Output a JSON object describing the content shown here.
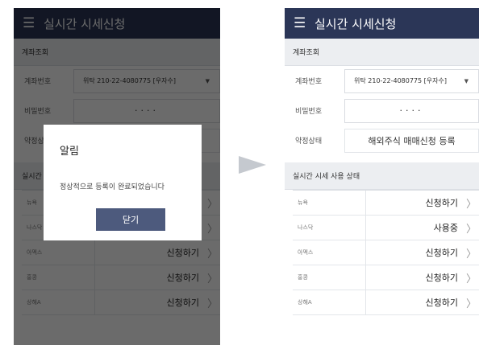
{
  "appbar": {
    "menu_icon": "☰",
    "title": "실시간 시세신청"
  },
  "account_section": {
    "title": "계좌조회"
  },
  "form": {
    "account_label": "계좌번호",
    "account_value": "위탁  210-22-4080775  [우자수]",
    "password_label": "비밀번호",
    "password_value": "····",
    "agreement_label": "약정상태",
    "agreement_value": "해외주식 매매신청 등록"
  },
  "usage_section": {
    "title": "실시간 시세 사용 상태"
  },
  "markets": [
    {
      "name": "뉴욕",
      "status": "신청하기"
    },
    {
      "name": "나스닥",
      "status": "사용중"
    },
    {
      "name": "아멕스",
      "status": "신청하기"
    },
    {
      "name": "홍콩",
      "status": "신청하기"
    },
    {
      "name": "상해A",
      "status": "신청하기"
    }
  ],
  "dialog": {
    "title": "알림",
    "message": "정상적으로 등록이 완료되었습니다",
    "close_label": "닫기"
  },
  "icons": {
    "caret": "▼",
    "chevron": "〉"
  },
  "colors": {
    "appbar": "#2b3657",
    "dialog_button": "#4d5a7d",
    "arrow": "#c5c9cf"
  }
}
